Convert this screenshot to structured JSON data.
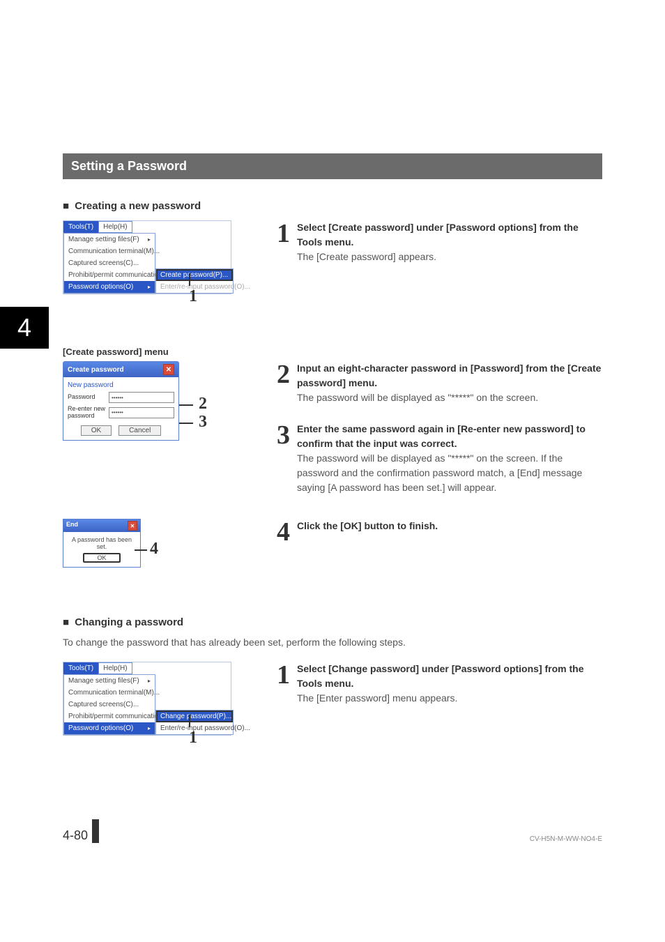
{
  "chapter_number": "4",
  "section_title": "Setting a Password",
  "sub1_title": "Creating a new password",
  "sub2_title": "Changing a password",
  "change_intro": "To change the password that has already been set, perform the following steps.",
  "tools_menu": {
    "tabs": {
      "active": "Tools(T)",
      "next": "Help(H)"
    },
    "items": [
      "Manage setting files(F)",
      "Communication terminal(M)...",
      "Captured screens(C)...",
      "Prohibit/permit communication(P)...",
      "Password options(O)"
    ],
    "arrow": "▸",
    "sub_create": "Create password(P)...",
    "sub_change": "Change password(P)...",
    "sub_dimmed": "Enter/re-input password(O)...",
    "callout": "1"
  },
  "create_caption": "[Create password] menu",
  "create_dlg": {
    "title": "Create password",
    "group": "New password",
    "f1_label": "Password",
    "f2_label": "Re-enter new password",
    "mask": "••••••",
    "ok": "OK",
    "cancel": "Cancel",
    "co2": "2",
    "co3": "3"
  },
  "end_dlg": {
    "title": "End",
    "msg": "A password has been set.",
    "ok": "OK",
    "co": "4"
  },
  "steps_create": [
    {
      "num": "1",
      "bold": "Select [Create password] under [Password options] from the Tools menu.",
      "plain": "The [Create password] appears."
    },
    {
      "num": "2",
      "bold": "Input an eight-character password in [Password] from the [Create password] menu.",
      "plain": "The password will be displayed as \"*****\" on the screen."
    },
    {
      "num": "3",
      "bold": "Enter the same password again in [Re-enter new password] to confirm that the input was correct.",
      "plain": "The password will be displayed as \"*****\" on the screen. If the password and the confirmation password match, a [End] message saying [A password has been set.] will appear."
    },
    {
      "num": "4",
      "bold": "Click the [OK] button to finish.",
      "plain": ""
    }
  ],
  "steps_change": [
    {
      "num": "1",
      "bold": "Select [Change password] under [Password options] from the Tools menu.",
      "plain": "The [Enter password] menu appears."
    }
  ],
  "footer": {
    "page": "4-80",
    "doc_id": "CV-H5N-M-WW-NO4-E"
  }
}
